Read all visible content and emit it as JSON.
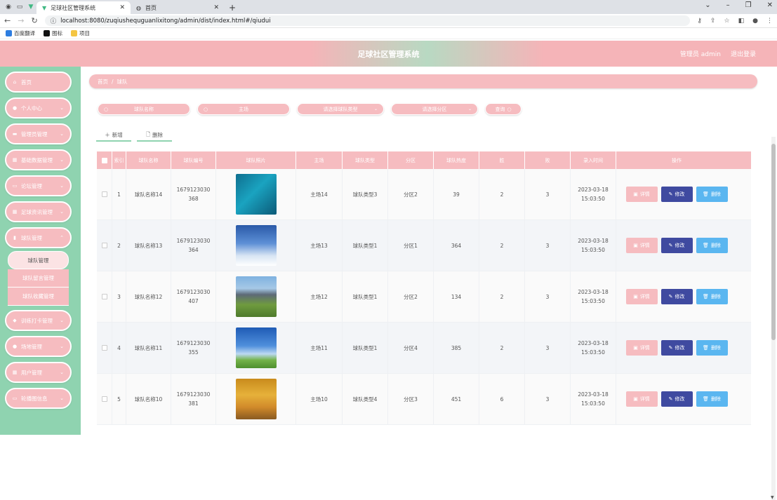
{
  "browser": {
    "tabs": [
      {
        "title": "足球社区管理系统",
        "active": true
      },
      {
        "title": "首页",
        "active": false
      }
    ],
    "url": "localhost:8080/zuqiushequguanlixitong/admin/dist/index.html#/qiudui",
    "bookmarks": [
      "百度翻译",
      "图标",
      "项目"
    ]
  },
  "header": {
    "title": "足球社区管理系统",
    "user": "管理员 admin",
    "logout": "退出登录"
  },
  "sidebar": {
    "items": [
      {
        "label": "首页",
        "icon": "home-icon",
        "chevron": false
      },
      {
        "label": "个人中心",
        "icon": "user-icon",
        "chevron": true
      },
      {
        "label": "管理员管理",
        "icon": "message-icon",
        "chevron": true
      },
      {
        "label": "基础数据管理",
        "icon": "grid-icon",
        "chevron": true
      },
      {
        "label": "论坛管理",
        "icon": "monitor-icon",
        "chevron": true
      },
      {
        "label": "足球资讯管理",
        "icon": "grid-icon",
        "chevron": true
      },
      {
        "label": "球队管理",
        "icon": "chart-icon",
        "chevron": true
      },
      {
        "label": "训练打卡管理",
        "icon": "shield-icon",
        "chevron": true
      },
      {
        "label": "场地管理",
        "icon": "user-icon",
        "chevron": true
      },
      {
        "label": "用户管理",
        "icon": "grid-icon",
        "chevron": true
      },
      {
        "label": "轮播图信息",
        "icon": "monitor-icon",
        "chevron": true
      }
    ],
    "submenu": [
      "球队管理",
      "球队留言管理",
      "球队收藏管理"
    ]
  },
  "breadcrumb": {
    "home": "首页",
    "sep": "/",
    "current": "球队"
  },
  "filters": {
    "name_placeholder": "球队名称",
    "home_placeholder": "主场",
    "type_placeholder": "请选择球队类型",
    "zone_placeholder": "请选择分区",
    "search": "查询"
  },
  "actions": {
    "add": "新增",
    "delete": "删除"
  },
  "table": {
    "headers": [
      "索引",
      "球队名称",
      "球队编号",
      "球队照片",
      "主场",
      "球队类型",
      "分区",
      "球队热度",
      "胜",
      "败",
      "录入时间",
      "操作"
    ],
    "rows": [
      {
        "index": "1",
        "name": "球队名称14",
        "code": "1679123030368",
        "home": "主场14",
        "type": "球队类型3",
        "zone": "分区2",
        "heat": "39",
        "win": "2",
        "lose": "3",
        "time": "2023-03-18 15:03:50",
        "photo": "heart"
      },
      {
        "index": "2",
        "name": "球队名称13",
        "code": "1679123030364",
        "home": "主场13",
        "type": "球队类型1",
        "zone": "分区1",
        "heat": "364",
        "win": "2",
        "lose": "3",
        "time": "2023-03-18 15:03:50",
        "photo": "snow"
      },
      {
        "index": "3",
        "name": "球队名称12",
        "code": "1679123030407",
        "home": "主场12",
        "type": "球队类型1",
        "zone": "分区2",
        "heat": "134",
        "win": "2",
        "lose": "3",
        "time": "2023-03-18 15:03:50",
        "photo": "mountain"
      },
      {
        "index": "4",
        "name": "球队名称11",
        "code": "1679123030355",
        "home": "主场11",
        "type": "球队类型1",
        "zone": "分区4",
        "heat": "385",
        "win": "2",
        "lose": "3",
        "time": "2023-03-18 15:03:50",
        "photo": "sky"
      },
      {
        "index": "5",
        "name": "球队名称10",
        "code": "1679123030381",
        "home": "主场10",
        "type": "球队类型4",
        "zone": "分区3",
        "heat": "451",
        "win": "6",
        "lose": "3",
        "time": "2023-03-18 15:03:50",
        "photo": "autumn"
      }
    ],
    "op_detail": "详情",
    "op_edit": "修改",
    "op_delete": "删除"
  },
  "colors": {
    "pink": "#f6bcc0",
    "green": "#8fd3b0",
    "edit": "#3f4aa0",
    "del": "#5ab6f0"
  }
}
